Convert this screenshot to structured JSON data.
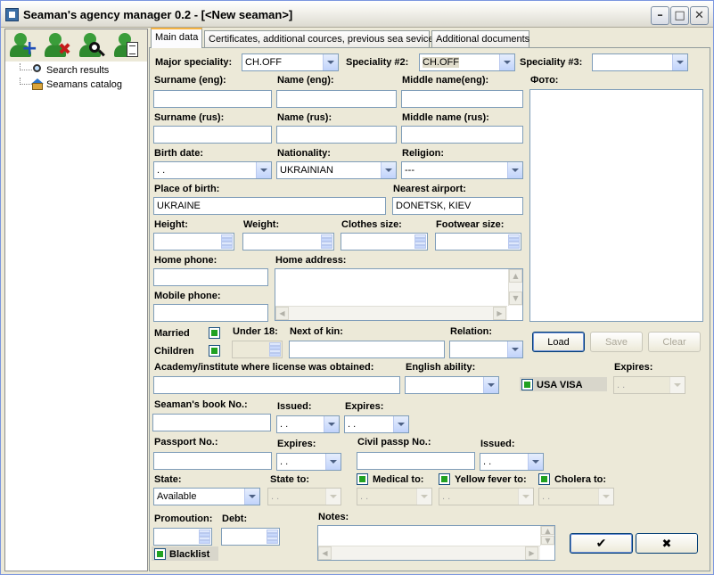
{
  "window": {
    "title": "Seaman's agency manager 0.2 - [<New seaman>]"
  },
  "titlebar_buttons": {
    "minimize": "–",
    "maximize": "□",
    "close": "✕"
  },
  "left": {
    "toolbar": [
      "add-seaman-icon",
      "delete-seaman-icon",
      "search-seaman-icon",
      "seaman-report-icon"
    ],
    "tree": [
      {
        "label": "Search results",
        "icon": "search-icon"
      },
      {
        "label": "Seamans catalog",
        "icon": "home-icon"
      }
    ]
  },
  "tabs": [
    "Main data",
    "Certificates, additional cources, previous sea sevice",
    "Additional documents"
  ],
  "labels": {
    "major_speciality": "Major speciality:",
    "speciality2": "Speciality #2:",
    "speciality3": "Speciality #3:",
    "surname_eng": "Surname (eng):",
    "name_eng": "Name (eng):",
    "middle_eng": "Middle name(eng):",
    "foto": "Фото:",
    "surname_rus": "Surname (rus):",
    "name_rus": "Name (rus):",
    "middle_rus": "Middle name (rus):",
    "birth_date": "Birth date:",
    "nationality": "Nationality:",
    "religion": "Religion:",
    "place_of_birth": "Place of birth:",
    "nearest_airport": "Nearest airport:",
    "height": "Height:",
    "weight": "Weight:",
    "clothes_size": "Clothes size:",
    "footwear_size": "Footwear size:",
    "home_phone": "Home phone:",
    "home_address": "Home address:",
    "mobile_phone": "Mobile phone:",
    "married": "Married",
    "children": "Children",
    "under18": "Under 18:",
    "next_of_kin": "Next of kin:",
    "relation": "Relation:",
    "academy": "Academy/institute where license was obtained:",
    "english": "English ability:",
    "usa_visa": "USA VISA",
    "expires": "Expires:",
    "seamans_book": "Seaman's book No.:",
    "issued": "Issued:",
    "passport": "Passport No.:",
    "civil_passport": "Civil passp No.:",
    "state": "State:",
    "state_to": "State to:",
    "medical_to": "Medical to:",
    "yellow_fever_to": "Yellow fever to:",
    "cholera_to": "Cholera to:",
    "promoution": "Promoution:",
    "debt": "Debt:",
    "notes": "Notes:",
    "blacklist": "Blacklist"
  },
  "values": {
    "major_speciality": "CH.OFF",
    "speciality2": "CH.OFF",
    "speciality3": "",
    "birth_date": " . .",
    "nationality": "UKRAINIAN",
    "religion": "---",
    "place_of_birth": "UKRAINE",
    "nearest_airport": "DONETSK, KIEV",
    "date_blank": " . .",
    "state": "Available"
  },
  "buttons": {
    "load": "Load",
    "save": "Save",
    "clear": "Clear",
    "ok": "✔",
    "cancel": "✖"
  }
}
